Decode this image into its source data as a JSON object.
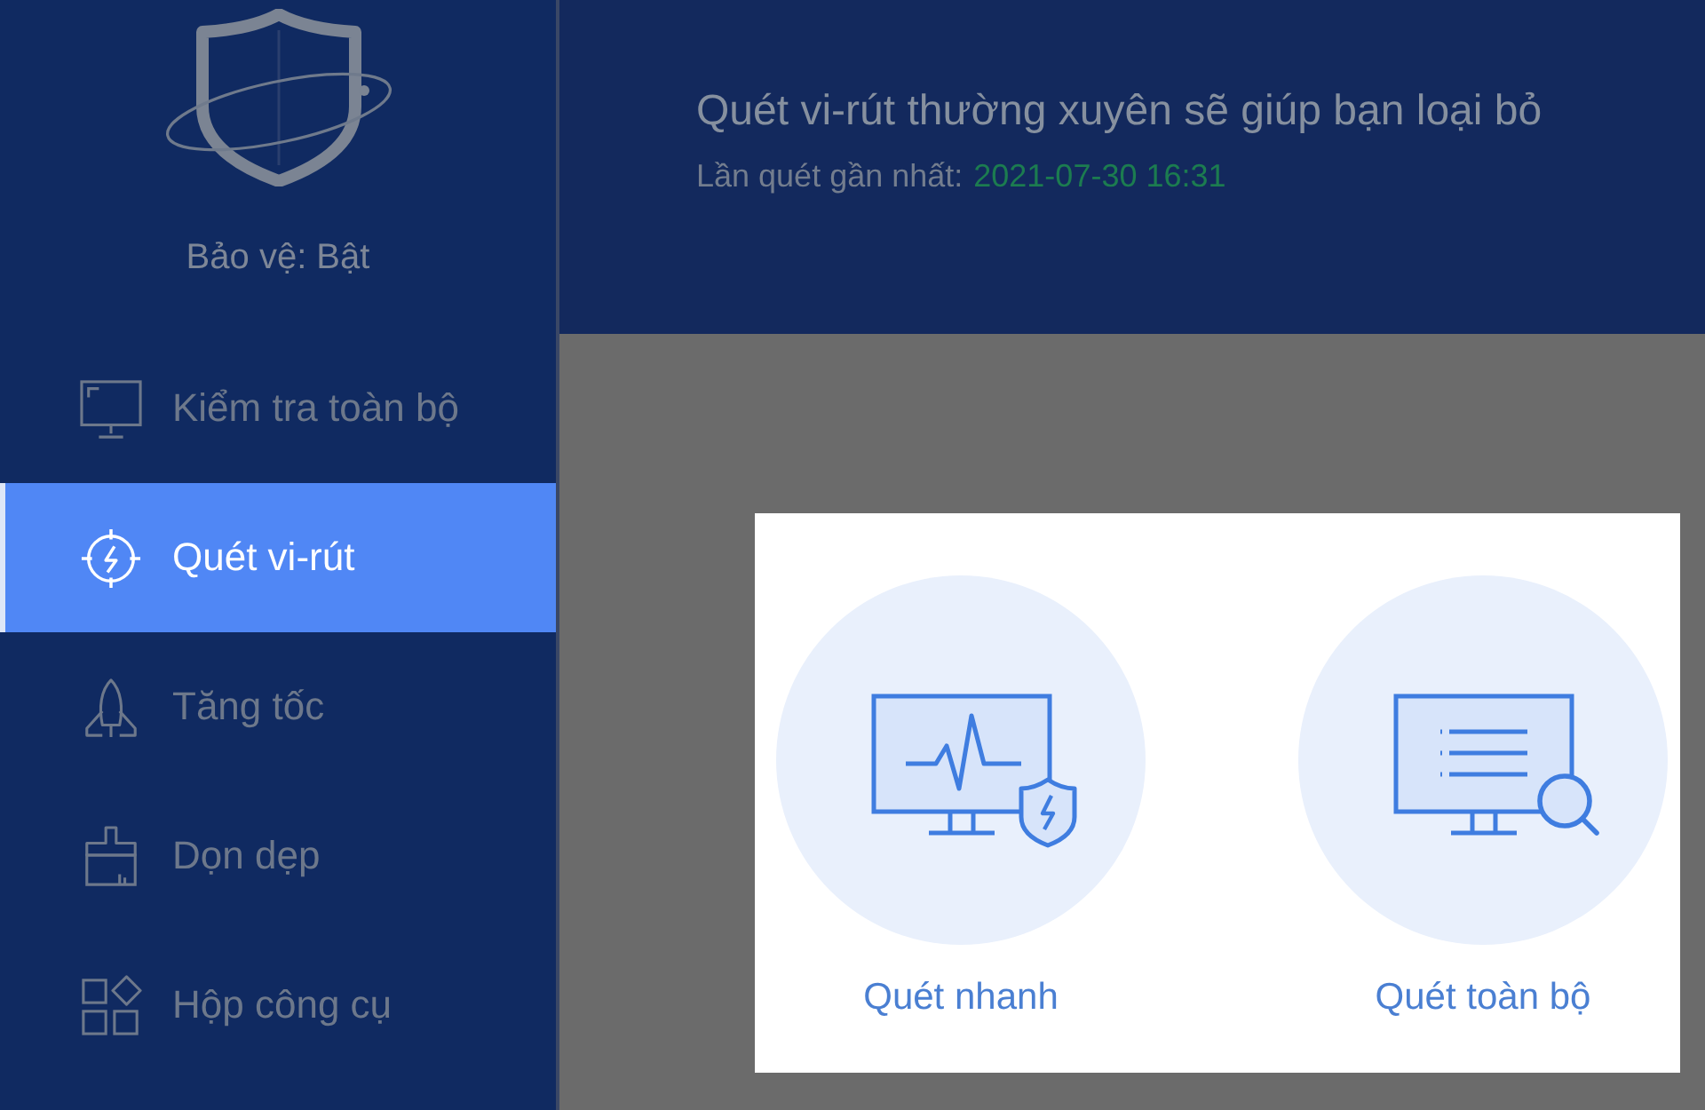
{
  "sidebar": {
    "status": "Bảo vệ: Bật",
    "items": [
      {
        "label": "Kiểm tra toàn bộ",
        "kind": "monitor",
        "selected": false
      },
      {
        "label": "Quét vi-rút",
        "kind": "target",
        "selected": true
      },
      {
        "label": "Tăng tốc",
        "kind": "rocket",
        "selected": false
      },
      {
        "label": "Dọn dẹp",
        "kind": "brush",
        "selected": false
      },
      {
        "label": "Hộp công cụ",
        "kind": "tools",
        "selected": false
      }
    ]
  },
  "header": {
    "message": "Quét vi-rút thường xuyên sẽ giúp bạn loại bỏ",
    "last_scan_label": "Lần quét gần nhất:",
    "last_scan_time": "2021-07-30 16:31"
  },
  "scan_options": [
    {
      "label": "Quét nhanh",
      "kind": "quick"
    },
    {
      "label": "Quét toàn bộ",
      "kind": "full"
    }
  ]
}
